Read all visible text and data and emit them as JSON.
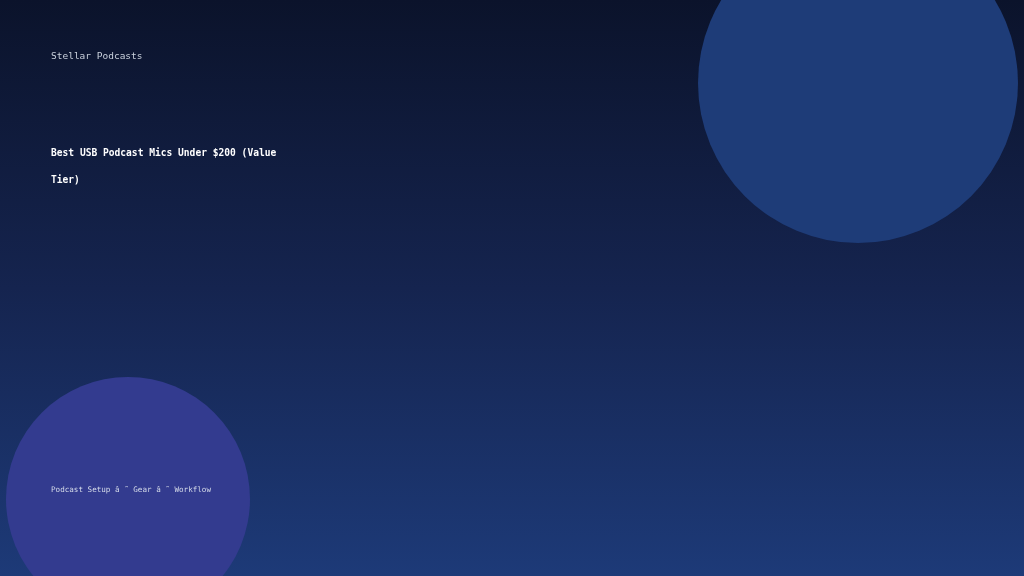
{
  "brand": "Stellar Podcasts",
  "title": "Best USB Podcast Mics Under $200 (Value Tier)",
  "footer": "Podcast Setup â ˜ Gear â ˜ Workflow"
}
